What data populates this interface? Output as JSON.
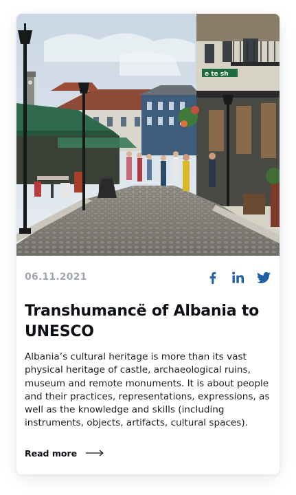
{
  "article": {
    "date": "06.11.2021",
    "title": "Transhumancë of Albania to UNESCO",
    "description": "Albania’s cultural heritage is more than its vast physical heritage of castle, archaeological ruins, museum and remote monuments. It is about people and their practices, representations, expressions, as well as the knowledge and skills (including instruments, objects, artifacts, cultural spaces).",
    "read_more_label": "Read more",
    "image_sign_text": "e te sh"
  },
  "share": {
    "icons": [
      "facebook-icon",
      "linkedin-icon",
      "twitter-icon"
    ],
    "color": "#1f5fa6"
  },
  "colors": {
    "accent": "#1f5fa6",
    "date": "#a0a6ad",
    "title": "#0c0f14"
  }
}
